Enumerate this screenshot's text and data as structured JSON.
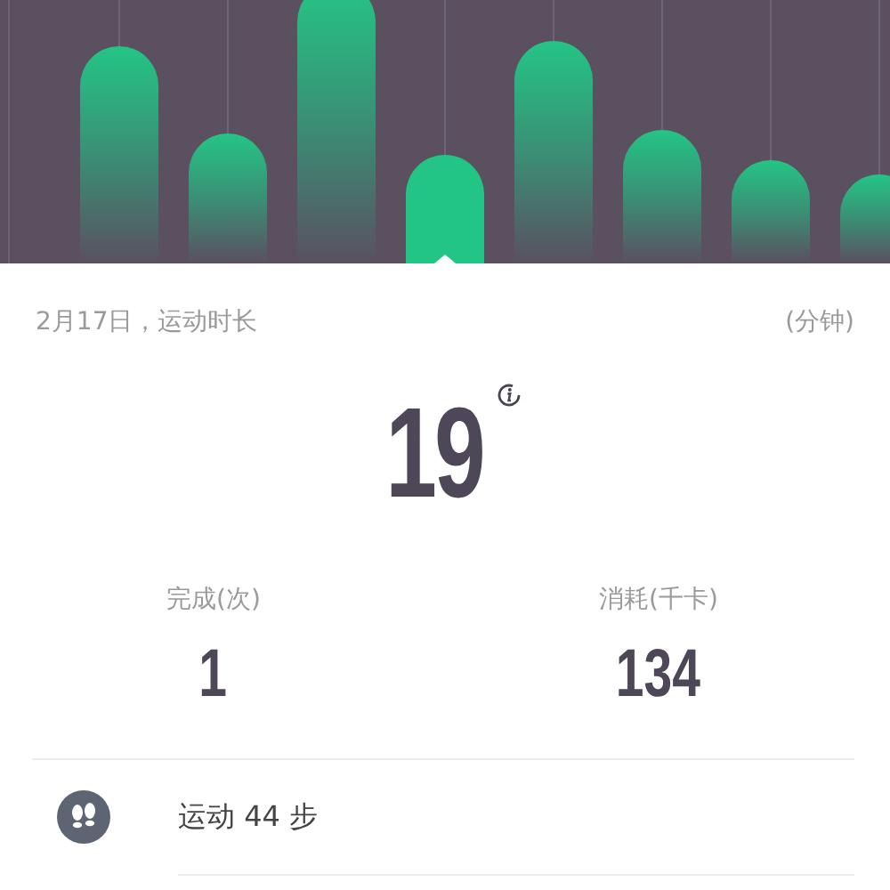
{
  "chart": {
    "bars": [
      {
        "selected": false
      },
      {
        "selected": false
      },
      {
        "selected": false
      },
      {
        "selected": true
      },
      {
        "selected": false
      },
      {
        "selected": false
      },
      {
        "selected": false
      },
      {
        "selected": false
      }
    ]
  },
  "header": {
    "date_title": "2月17日，运动时长",
    "unit": "(分钟)"
  },
  "duration": {
    "value": "19"
  },
  "stats": [
    {
      "label": "完成(次)",
      "value": "1"
    },
    {
      "label": "消耗(千卡)",
      "value": "134"
    }
  ],
  "activities": [
    {
      "text": "运动 44 步"
    }
  ]
}
